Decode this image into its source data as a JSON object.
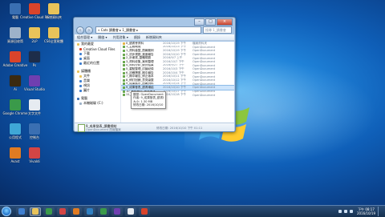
{
  "desktop": {
    "icons": [
      {
        "label": "電腦",
        "color": "#3a6fb2"
      },
      {
        "label": "Creative Cloud Files",
        "color": "#d9442b"
      },
      {
        "label": "新增資料夾",
        "color": "#e8c35a"
      },
      {
        "label": "資源回收筒",
        "color": "#9db2c9"
      },
      {
        "label": "2LP",
        "color": "#e8c35a"
      },
      {
        "label": "CS6全套軟體",
        "color": "#e8c35a"
      },
      {
        "label": "Adobe Creative",
        "color": "#d9442b"
      },
      {
        "label": "Ps",
        "color": "#1d2d4a"
      },
      {
        "label": "Ai",
        "color": "#3b2a10"
      },
      {
        "label": "Visual Studio",
        "color": "#6f3fb0"
      },
      {
        "label": "Google Chrome",
        "color": "#3a9a4a"
      },
      {
        "label": "文字文件",
        "color": "#e6ebf1"
      },
      {
        "label": "公用程式",
        "color": "#3fa7d6"
      },
      {
        "label": "控制台",
        "color": "#3a6fb2"
      },
      {
        "label": "Avast",
        "color": "#e07b22"
      },
      {
        "label": "Vivaldi",
        "color": "#d34545"
      }
    ]
  },
  "window": {
    "breadcrumb": "« Cats 讀書會 ▸ 1_讀書會 ▸",
    "search_placeholder": "搜尋 1_讀書會",
    "toolbar": [
      "組合管理 ▾",
      "開啟 ▾",
      "共用對象 ▾",
      "燒錄",
      "新增資料夾"
    ],
    "nav": [
      {
        "label": "我的最愛",
        "top": true,
        "color": "#e8c35a"
      },
      {
        "label": "Creative Cloud Files",
        "top": false,
        "color": "#d9442b"
      },
      {
        "label": "下載",
        "top": false,
        "color": "#3f7fd0"
      },
      {
        "label": "桌面",
        "top": false,
        "color": "#3f7fd0"
      },
      {
        "label": "最近的位置",
        "top": false,
        "color": "#3f7fd0"
      },
      {
        "gap": true
      },
      {
        "label": "媒體櫃",
        "top": true,
        "color": "#e8c35a"
      },
      {
        "label": "文件",
        "top": false,
        "color": "#e8c35a"
      },
      {
        "label": "音樂",
        "top": false,
        "color": "#3f7fd0"
      },
      {
        "label": "視訊",
        "top": false,
        "color": "#3f7fd0"
      },
      {
        "label": "圖片",
        "top": false,
        "color": "#3f7fd0"
      },
      {
        "gap": true
      },
      {
        "label": "電腦",
        "top": true,
        "color": "#3a6fb2"
      },
      {
        "label": "本機磁碟 (C:)",
        "top": false,
        "color": "#9db2c9"
      }
    ],
    "files": [
      {
        "name": "0_讀書會資料",
        "date": "2016/10/19 下午",
        "type": "檔案資料夾"
      },
      {
        "name": "1_主題概覽",
        "date": "2016/10/13 下午",
        "type": "OpenDocument"
      },
      {
        "name": "1_資料彙整_簡報範例",
        "date": "2016/10/19 下午",
        "type": "OpenDocument"
      },
      {
        "name": "2_初步規劃_進度報告",
        "date": "2016/10/10 下午",
        "type": "OpenDocument"
      },
      {
        "name": "2_計畫書_整體規劃",
        "date": "2016/9/7 上午",
        "type": "OpenDocument"
      },
      {
        "name": "3_資料收集_案例整理",
        "date": "2016/10/7 下午",
        "type": "OpenDocument"
      },
      {
        "name": "4_資料分析_統計結果",
        "date": "2016/9/27 下午",
        "type": "OpenDocument"
      },
      {
        "name": "5_重點整理_討論紀錄",
        "date": "2016/10/3 下午",
        "type": "OpenDocument"
      },
      {
        "name": "6_初稿撰寫_期中報告",
        "date": "2016/10/4 下午",
        "type": "OpenDocument"
      },
      {
        "name": "7_期中報告_修正版本",
        "date": "2016/10/11 下午",
        "type": "OpenDocument"
      },
      {
        "name": "8_修訂回饋_意見彙整",
        "date": "2016/10/12 下午",
        "type": "OpenDocument"
      },
      {
        "name": "9_成果展示_簡報資料",
        "date": "2016/10/14 下午",
        "type": "OpenDocument"
      },
      {
        "name": "9_成果發表_讀書總結",
        "date": "2016/10/10 下午",
        "type": "OpenDocument"
      },
      {
        "name": "10_最終報告_完整版本",
        "date": "2016/10/17 下午",
        "type": "OpenDocument"
      },
      {
        "name": "11_附錄資料_參考文獻",
        "date": "2016/10/18 下午",
        "type": "OpenDocument"
      }
    ],
    "selected_index": 12,
    "tooltip": [
      "類型: OpenDocument 簡報",
      "作者: 9_成果發表_讀書總結",
      "大小: 1.30 MB",
      "修改日期: 2016/10/10 下午 10:33"
    ],
    "details": {
      "name": "9_成果發表_讀書總結",
      "type": "OpenDocument 簡報檔案",
      "modified": "修改日期: 2016/10/10 下午 01:11"
    }
  },
  "taskbar": {
    "apps": [
      {
        "color": "#3f7fd0",
        "active": false
      },
      {
        "color": "#e8c35a",
        "active": true
      },
      {
        "color": "#3a9a4a",
        "active": false
      },
      {
        "color": "#d34545",
        "active": false
      },
      {
        "color": "#e07b22",
        "active": false
      },
      {
        "color": "#2f7fc1",
        "active": false
      },
      {
        "color": "#3a9a4a",
        "active": false
      },
      {
        "color": "#6f3fb0",
        "active": false
      },
      {
        "color": "#e6ebf1",
        "active": false
      },
      {
        "color": "#d9442b",
        "active": false
      }
    ],
    "clock_time": "下午 08:17",
    "clock_date": "2016/10/19"
  }
}
